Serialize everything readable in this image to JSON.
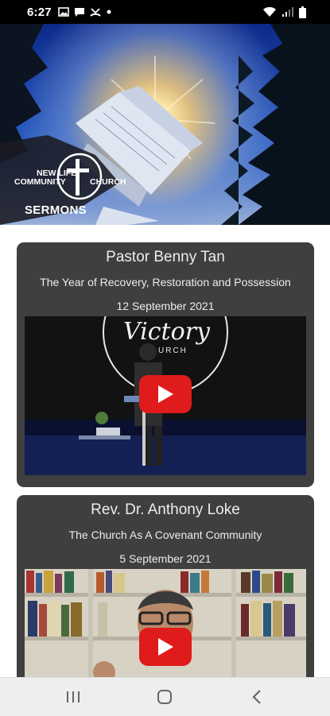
{
  "status_bar": {
    "time": "6:27",
    "icons": [
      "image-icon",
      "message-icon",
      "missed-call-icon",
      "dot-icon"
    ],
    "right_icons": [
      "wifi-icon",
      "signal-icon",
      "battery-icon"
    ]
  },
  "hero": {
    "logo_line1": "NEW LIFE",
    "logo_line2": "COMMUNITY",
    "logo_line3": "CHURCH",
    "section_label": "SERMONS"
  },
  "sermons": [
    {
      "speaker": "Pastor Benny Tan",
      "title": "The Year of Recovery, Restoration and Possession",
      "date": "12 September 2021",
      "thumbnail_logo_text": "Victory",
      "thumbnail_logo_sub": "URCH"
    },
    {
      "speaker": "Rev. Dr. Anthony Loke",
      "title": "The Church As A Covenant Community",
      "date": "5 September 2021"
    }
  ],
  "nav_bar": {
    "icons": [
      "recent-apps-icon",
      "home-icon",
      "back-icon"
    ]
  },
  "colors": {
    "card_bg": "#3f3f3f",
    "play_red": "#e01b1b",
    "status_bg": "#000000",
    "nav_bg": "#eeeeee"
  }
}
